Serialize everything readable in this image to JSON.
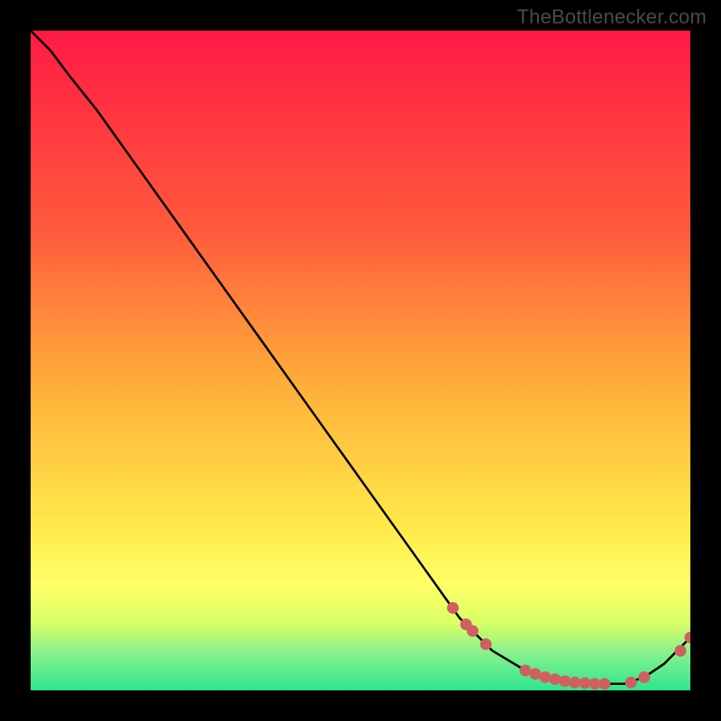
{
  "watermark": "TheBottlenecker.com",
  "chart_data": {
    "type": "line",
    "title": "",
    "xlabel": "",
    "ylabel": "",
    "xlim": [
      0,
      100
    ],
    "ylim": [
      0,
      100
    ],
    "gradient_stops": [
      {
        "offset": 0,
        "color": "#ff1a44"
      },
      {
        "offset": 0.3,
        "color": "#ff5a3c"
      },
      {
        "offset": 0.55,
        "color": "#ffb23a"
      },
      {
        "offset": 0.75,
        "color": "#ffe94a"
      },
      {
        "offset": 0.84,
        "color": "#ffff66"
      },
      {
        "offset": 0.9,
        "color": "#d6ff66"
      },
      {
        "offset": 0.94,
        "color": "#8cf28c"
      },
      {
        "offset": 1.0,
        "color": "#2ee58f"
      }
    ],
    "series": [
      {
        "name": "curve",
        "stroke": "#000000",
        "points": [
          {
            "x": 0,
            "y": 100
          },
          {
            "x": 3,
            "y": 97
          },
          {
            "x": 6,
            "y": 93
          },
          {
            "x": 10,
            "y": 88
          },
          {
            "x": 20,
            "y": 74
          },
          {
            "x": 30,
            "y": 60
          },
          {
            "x": 40,
            "y": 46
          },
          {
            "x": 50,
            "y": 32
          },
          {
            "x": 60,
            "y": 18
          },
          {
            "x": 65,
            "y": 11
          },
          {
            "x": 70,
            "y": 6
          },
          {
            "x": 75,
            "y": 3
          },
          {
            "x": 80,
            "y": 1.5
          },
          {
            "x": 85,
            "y": 1
          },
          {
            "x": 90,
            "y": 1
          },
          {
            "x": 93,
            "y": 2
          },
          {
            "x": 96,
            "y": 4
          },
          {
            "x": 100,
            "y": 8
          }
        ],
        "markers": [
          {
            "x": 64,
            "y": 12.5
          },
          {
            "x": 66,
            "y": 10
          },
          {
            "x": 67,
            "y": 9
          },
          {
            "x": 69,
            "y": 7
          },
          {
            "x": 75,
            "y": 3
          },
          {
            "x": 76.5,
            "y": 2.5
          },
          {
            "x": 78,
            "y": 2
          },
          {
            "x": 79.5,
            "y": 1.7
          },
          {
            "x": 81,
            "y": 1.4
          },
          {
            "x": 82.5,
            "y": 1.2
          },
          {
            "x": 84,
            "y": 1.1
          },
          {
            "x": 85.5,
            "y": 1
          },
          {
            "x": 87,
            "y": 1
          },
          {
            "x": 91,
            "y": 1.2
          },
          {
            "x": 93,
            "y": 2
          },
          {
            "x": 98.5,
            "y": 6
          },
          {
            "x": 100,
            "y": 8
          }
        ],
        "marker_color": "#d06060",
        "marker_radius": 6.5
      }
    ]
  }
}
